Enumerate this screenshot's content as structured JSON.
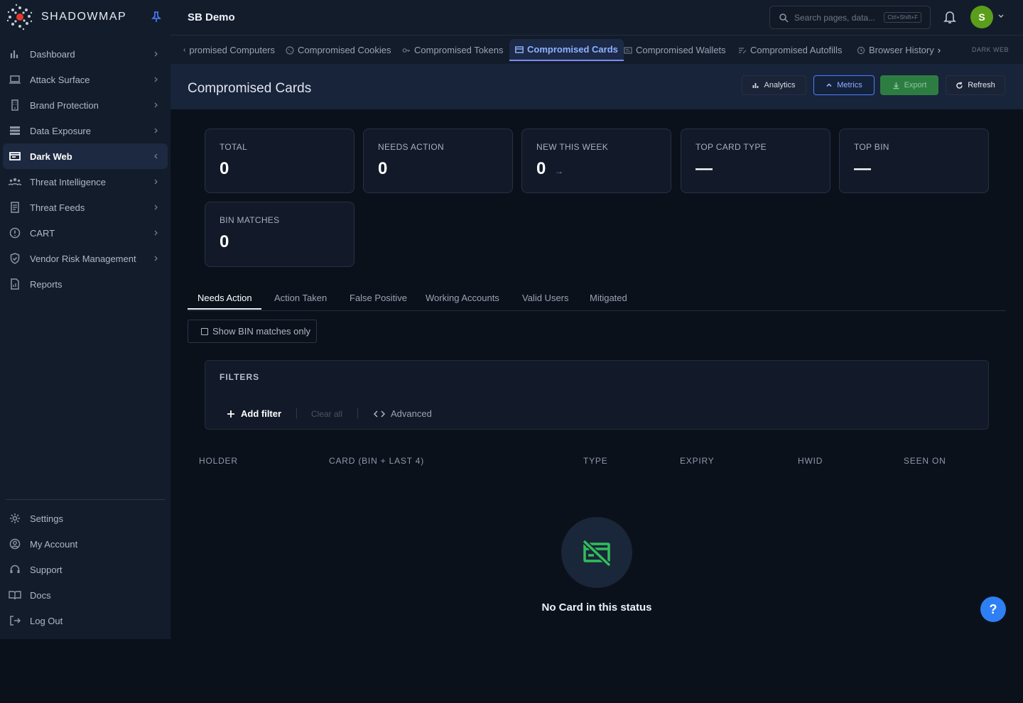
{
  "brand": {
    "name": "SHADOWMAP",
    "pin_icon": "pin-icon"
  },
  "sidebar": {
    "items": [
      {
        "label": "Dashboard",
        "icon": "bar-chart-icon"
      },
      {
        "label": "Attack Surface",
        "icon": "laptop-icon"
      },
      {
        "label": "Brand Protection",
        "icon": "building-icon"
      },
      {
        "label": "Data Exposure",
        "icon": "database-icon"
      },
      {
        "label": "Dark Web",
        "icon": "browser-window-icon",
        "active": true
      },
      {
        "label": "Threat Intelligence",
        "icon": "users-icon"
      },
      {
        "label": "Threat Feeds",
        "icon": "document-icon"
      },
      {
        "label": "CART",
        "icon": "alert-circle-icon"
      },
      {
        "label": "Vendor Risk Management",
        "icon": "shield-icon"
      },
      {
        "label": "Reports",
        "icon": "report-icon"
      }
    ],
    "bottom": [
      {
        "label": "Settings",
        "icon": "gear-icon"
      },
      {
        "label": "My Account",
        "icon": "user-circle-icon"
      },
      {
        "label": "Support",
        "icon": "headset-icon"
      },
      {
        "label": "Docs",
        "icon": "book-icon"
      },
      {
        "label": "Log Out",
        "icon": "logout-icon"
      }
    ]
  },
  "topbar": {
    "org": "SB Demo",
    "search_placeholder": "Search pages, data...",
    "search_shortcut": "Ctrl+Shift+F",
    "avatar_initial": "S",
    "avatar_color": "#5a9e1b"
  },
  "tabs": {
    "items": [
      {
        "label": "promised Computers"
      },
      {
        "label": "Compromised Cookies"
      },
      {
        "label": "Compromised Tokens"
      },
      {
        "label": "Compromised Cards",
        "active": true
      },
      {
        "label": "Compromised Wallets"
      },
      {
        "label": "Compromised Autofills"
      },
      {
        "label": "Browser History"
      }
    ],
    "section_label": "DARK WEB"
  },
  "page": {
    "title": "Compromised Cards",
    "buttons": {
      "analytics": "Analytics",
      "metrics": "Metrics",
      "export": "Export",
      "refresh": "Refresh"
    }
  },
  "stats": [
    {
      "label": "TOTAL",
      "value": "0"
    },
    {
      "label": "NEEDS ACTION",
      "value": "0"
    },
    {
      "label": "NEW THIS WEEK",
      "value": "0",
      "trend": "→"
    },
    {
      "label": "TOP CARD TYPE",
      "value": "—"
    },
    {
      "label": "TOP BIN",
      "value": "—"
    },
    {
      "label": "BIN MATCHES",
      "value": "0"
    }
  ],
  "status_tabs": [
    "Needs Action",
    "Action Taken",
    "False Positive",
    "Working Accounts",
    "Valid Users",
    "Mitigated"
  ],
  "bin_toggle": "Show BIN matches only",
  "filters": {
    "title": "FILTERS",
    "add": "Add filter",
    "clear": "Clear all",
    "advanced": "Advanced"
  },
  "table": {
    "columns": [
      "HOLDER",
      "CARD (BIN + LAST 4)",
      "TYPE",
      "EXPIRY",
      "HWID",
      "SEEN ON"
    ]
  },
  "empty_state": {
    "message": "No Card in this status",
    "icon": "card-off-icon",
    "icon_color": "#2fbf5a"
  },
  "help_label": "?",
  "colors": {
    "accent": "#4d7fff",
    "export": "#2d7d43",
    "help": "#2f7ff4"
  }
}
